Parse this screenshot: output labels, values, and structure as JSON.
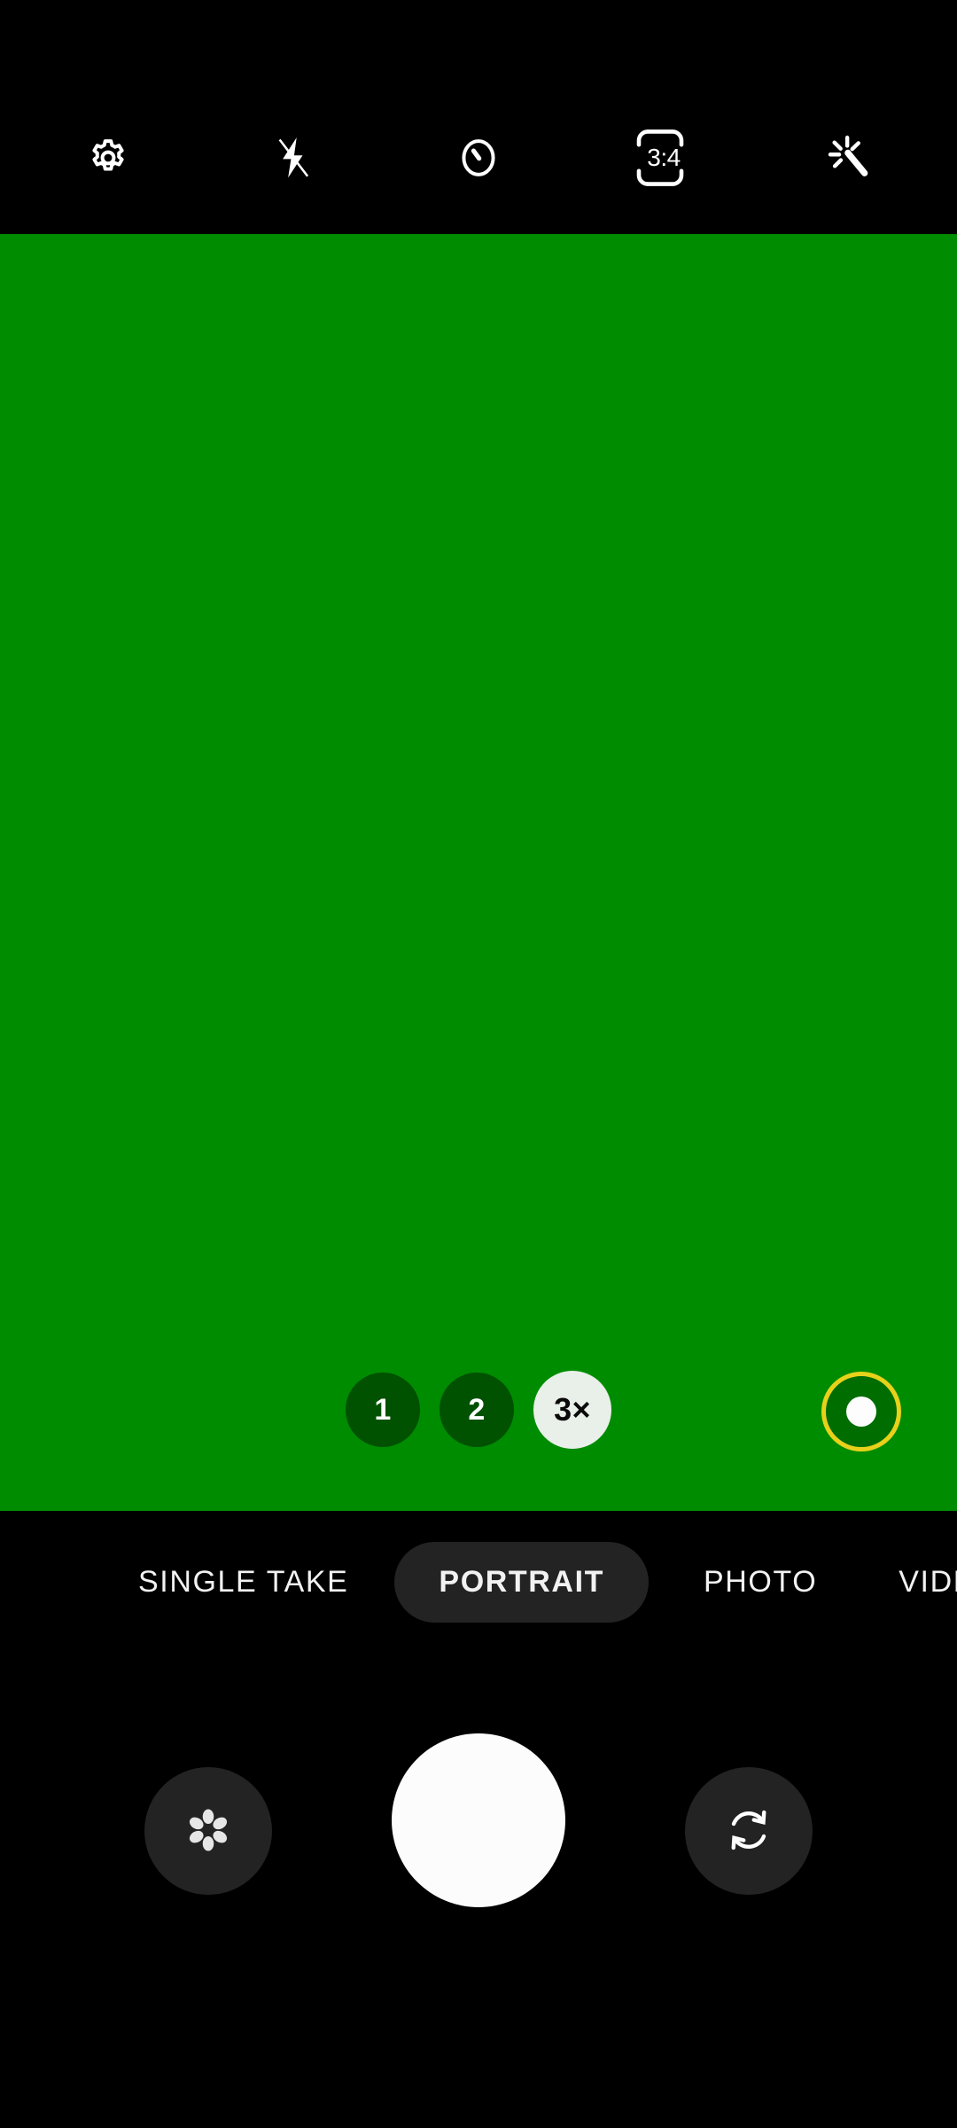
{
  "app": {
    "name": "Camera",
    "accent_green": "#008c00",
    "indicator_yellow": "#e8d11a",
    "chip_active_bg": "#e9efe9",
    "tab_active_bg": "#232323"
  },
  "top_toolbar": {
    "items": [
      {
        "icon": "settings-gear-icon",
        "label": "Settings"
      },
      {
        "icon": "flash-off-icon",
        "label": "Flash off"
      },
      {
        "icon": "timer-icon",
        "label": "Timer"
      },
      {
        "icon": "aspect-ratio-icon",
        "label": "Aspect ratio",
        "value": "3:4"
      },
      {
        "icon": "magic-wand-icon",
        "label": "Filters and effects"
      }
    ],
    "aspect_ratio_value": "3:4"
  },
  "viewfinder": {
    "background_color": "#008c00",
    "zoom_chips": [
      {
        "label": "1",
        "value": "1",
        "active": false
      },
      {
        "label": "2",
        "value": "2",
        "active": false
      },
      {
        "label": "3×",
        "value": "3x",
        "active": true
      }
    ],
    "focus_indicator": {
      "icon": "focus-ring-icon",
      "ring_color": "#e8d11a",
      "dot_color": "#fdfdfd"
    }
  },
  "mode_tabs": [
    {
      "label": "SINGLE TAKE",
      "active": false
    },
    {
      "label": "PORTRAIT",
      "active": true
    },
    {
      "label": "PHOTO",
      "active": false
    },
    {
      "label": "VIDEO",
      "active": false
    }
  ],
  "bottom_bar": {
    "gallery": {
      "icon": "flower-gallery-icon",
      "label": "Gallery"
    },
    "shutter": {
      "icon": "shutter-icon",
      "label": "Shutter"
    },
    "flip": {
      "icon": "camera-flip-icon",
      "label": "Switch camera"
    }
  }
}
